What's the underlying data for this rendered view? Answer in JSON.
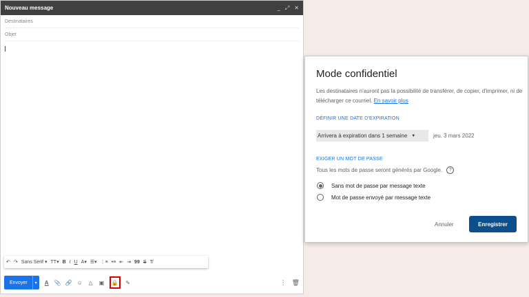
{
  "compose": {
    "title": "Nouveau message",
    "header_icons": [
      "minimize-icon",
      "expand-icon",
      "close-icon"
    ],
    "recipients_placeholder": "Destinataires",
    "subject_placeholder": "Objet",
    "format_bar": {
      "font": "Sans Serif",
      "font_size_icon": "TT",
      "bold": "B",
      "italic": "I",
      "underline": "U",
      "text_color": "A",
      "quote": "99"
    },
    "send_label": "Envoyer",
    "text_format_icon": "A"
  },
  "dialog": {
    "title": "Mode confidentiel",
    "description": "Les destinataires n'auront pas la possibilité de transférer, de copier, d'imprimer, ni de télécharger ce courriel. ",
    "learn_more": "En savoir plus",
    "expiry_section": "DÉFINIR UNE DATE D'EXPIRATION",
    "expiry_value": "Arrivera à expiration dans 1 semaine",
    "expiry_date": "jeu. 3 mars 2022",
    "password_section": "EXIGER UN MOT DE PASSE",
    "password_note": "Tous les mots de passe seront générés par Google.",
    "options": [
      {
        "label": "Sans mot de passe par message texte",
        "selected": true
      },
      {
        "label": "Mot de passe envoyé par message texte",
        "selected": false
      }
    ],
    "cancel_label": "Annuler",
    "save_label": "Enregistrer"
  },
  "colors": {
    "accent": "#1a73e8",
    "save": "#0b4f8c",
    "highlight": "#d50000",
    "header": "#404040"
  }
}
